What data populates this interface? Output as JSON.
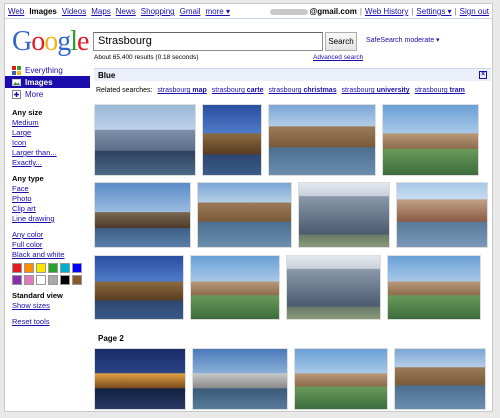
{
  "topnav": {
    "items": [
      "Web",
      "Images",
      "Videos",
      "Maps",
      "News",
      "Shopping",
      "Gmail",
      "more ▾"
    ],
    "active": "Images"
  },
  "account": {
    "email_suffix": "@gmail.com",
    "links": [
      "Web History",
      "Settings ▾",
      "Sign out"
    ]
  },
  "logo": {
    "letters": [
      "G",
      "o",
      "o",
      "g",
      "l",
      "e"
    ],
    "colors": [
      "#3366cc",
      "#e31b23",
      "#f2b50f",
      "#3366cc",
      "#2ca02c",
      "#e31b23"
    ]
  },
  "search": {
    "query": "Strasbourg",
    "button": "Search",
    "safesearch": "SafeSearch moderate ▾",
    "result_info": "About 65,400 results (0.18 seconds)",
    "advanced": "Advanced search"
  },
  "sidebar": {
    "nav": [
      {
        "label": "Everything",
        "icon": "everything-icon",
        "active": false
      },
      {
        "label": "Images",
        "icon": "images-icon",
        "active": true
      },
      {
        "label": "More",
        "icon": "plus-icon",
        "active": false
      }
    ],
    "size": {
      "heading": "Any size",
      "options": [
        "Medium",
        "Large",
        "Icon",
        "Larger than...",
        "Exactly..."
      ]
    },
    "type": {
      "heading": "Any type",
      "options": [
        "Face",
        "Photo",
        "Clip art",
        "Line drawing"
      ]
    },
    "color": {
      "options": [
        "Any color",
        "Full color",
        "Black and white"
      ],
      "swatches": [
        "#e41a1c",
        "#ff8c00",
        "#ffe600",
        "#2ca02c",
        "#00b0d0",
        "#0000ff",
        "#8b2bb0",
        "#e377c2",
        "#ffffff",
        "#aaaaaa",
        "#000000",
        "#8b5a2b"
      ]
    },
    "view": {
      "heading": "Standard view",
      "options": [
        "Show sizes"
      ]
    },
    "reset": "Reset tools"
  },
  "results": {
    "bar_title": "Blue",
    "close": "×",
    "related_label": "Related searches:",
    "related": [
      {
        "base": "strasbourg",
        "bold": "map"
      },
      {
        "base": "strasbourg",
        "bold": "carte"
      },
      {
        "base": "strasbourg",
        "bold": "christmas"
      },
      {
        "base": "strasbourg",
        "bold": "university"
      },
      {
        "base": "strasbourg",
        "bold": "tram"
      }
    ],
    "page2_label": "Page 2"
  }
}
